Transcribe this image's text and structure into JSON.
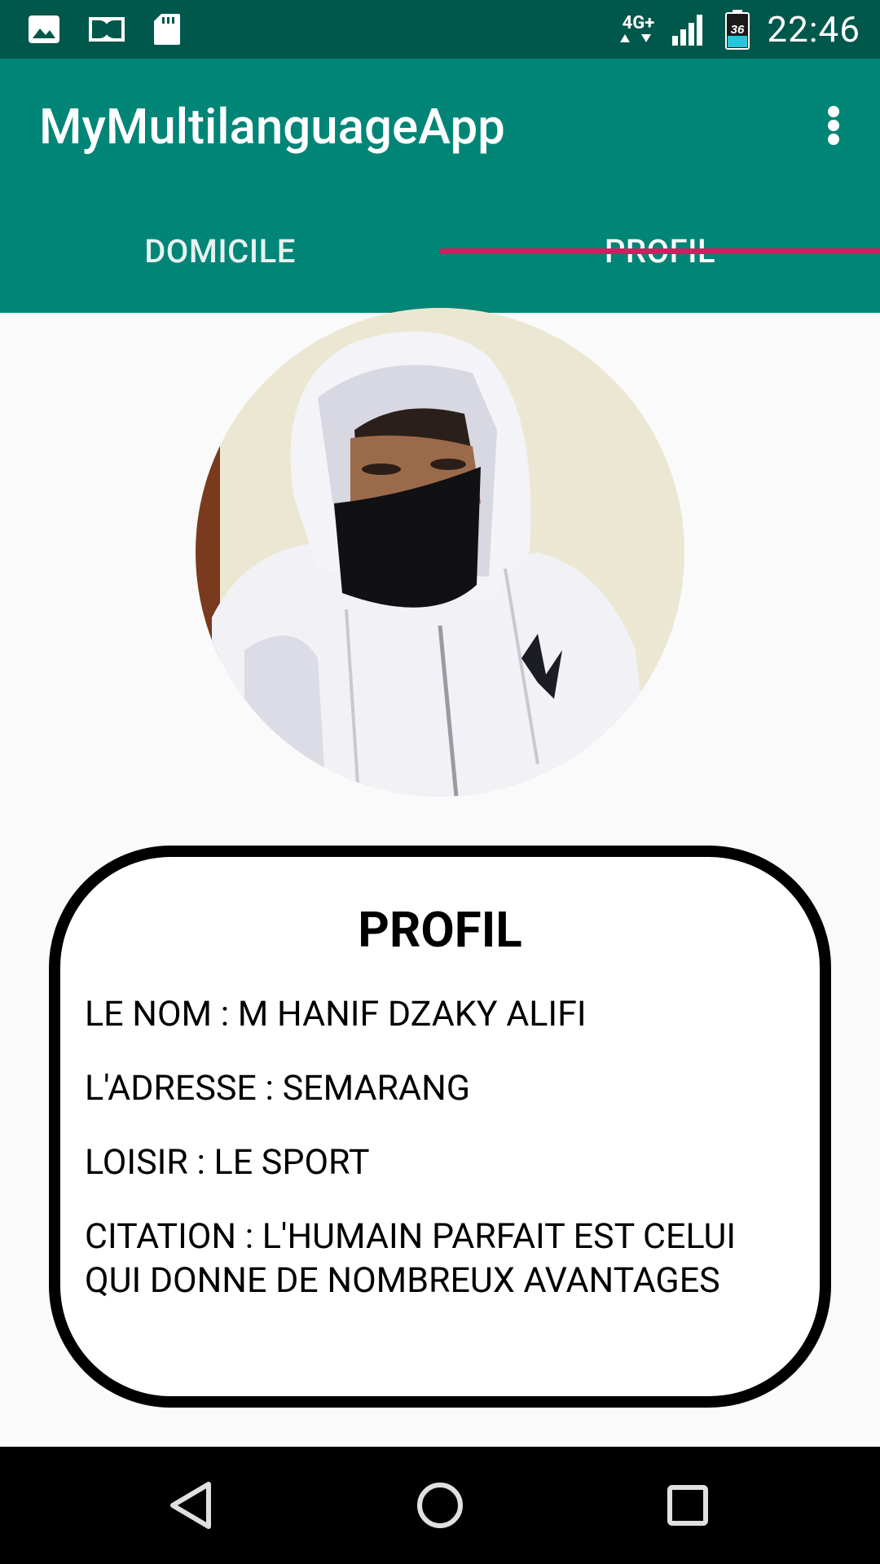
{
  "status_bar": {
    "time": "22:46",
    "network": "4G+",
    "battery_level": "36",
    "icons": [
      "image-icon",
      "dolby-icon",
      "sd-card-icon",
      "network-arrows-icon",
      "signal-icon",
      "battery-icon"
    ]
  },
  "app_bar": {
    "title": "MyMultilanguageApp",
    "menu_icon": "overflow-menu-icon"
  },
  "tabs": [
    {
      "label": "DOMICILE",
      "selected": false
    },
    {
      "label": "PROFIL",
      "selected": true
    }
  ],
  "colors": {
    "status_bar": "#00574b",
    "primary": "#008577",
    "accent": "#d81b60",
    "background": "#fafafa"
  },
  "profile": {
    "title": "PROFIL",
    "name_line": "LE NOM : M HANIF DZAKY ALIFI",
    "address_line": "L'ADRESSE : SEMARANG",
    "hobby_line": "LOISIR : LE SPORT",
    "quote_line_1": "CITATION : L'HUMAIN PARFAIT EST CELUI",
    "quote_line_2": "QUI DONNE DE NOMBREUX AVANTAGES"
  },
  "nav_bar": {
    "buttons": [
      "back-icon",
      "home-icon",
      "recents-icon"
    ]
  }
}
